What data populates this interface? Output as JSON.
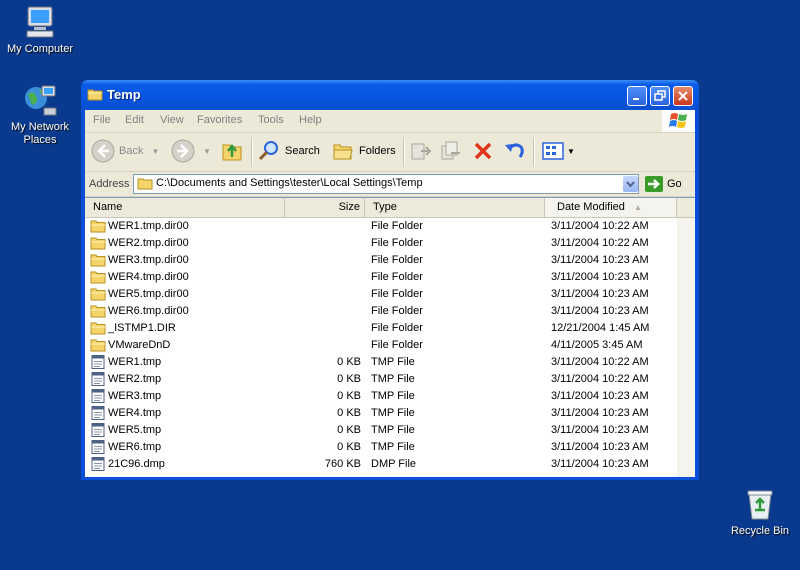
{
  "desktop": {
    "icons": [
      {
        "label": "My Computer"
      },
      {
        "label": "My Network Places"
      },
      {
        "label": "Recycle Bin"
      }
    ]
  },
  "window": {
    "title": "Temp",
    "menu": [
      "File",
      "Edit",
      "View",
      "Favorites",
      "Tools",
      "Help"
    ],
    "toolbar": {
      "back_label": "Back",
      "search_label": "Search",
      "folders_label": "Folders"
    },
    "address": {
      "label": "Address",
      "value": "C:\\Documents and Settings\\tester\\Local Settings\\Temp",
      "go_label": "Go"
    },
    "columns": {
      "name": "Name",
      "size": "Size",
      "type": "Type",
      "date": "Date Modified"
    },
    "files": [
      {
        "icon": "folder",
        "name": "WER1.tmp.dir00",
        "size": "",
        "type": "File Folder",
        "date": "3/11/2004 10:22 AM"
      },
      {
        "icon": "folder",
        "name": "WER2.tmp.dir00",
        "size": "",
        "type": "File Folder",
        "date": "3/11/2004 10:22 AM"
      },
      {
        "icon": "folder",
        "name": "WER3.tmp.dir00",
        "size": "",
        "type": "File Folder",
        "date": "3/11/2004 10:23 AM"
      },
      {
        "icon": "folder",
        "name": "WER4.tmp.dir00",
        "size": "",
        "type": "File Folder",
        "date": "3/11/2004 10:23 AM"
      },
      {
        "icon": "folder",
        "name": "WER5.tmp.dir00",
        "size": "",
        "type": "File Folder",
        "date": "3/11/2004 10:23 AM"
      },
      {
        "icon": "folder",
        "name": "WER6.tmp.dir00",
        "size": "",
        "type": "File Folder",
        "date": "3/11/2004 10:23 AM"
      },
      {
        "icon": "folder",
        "name": "_ISTMP1.DIR",
        "size": "",
        "type": "File Folder",
        "date": "12/21/2004 1:45 AM"
      },
      {
        "icon": "folder",
        "name": "VMwareDnD",
        "size": "",
        "type": "File Folder",
        "date": "4/11/2005 3:45 AM"
      },
      {
        "icon": "file",
        "name": "WER1.tmp",
        "size": "0 KB",
        "type": "TMP File",
        "date": "3/11/2004 10:22 AM"
      },
      {
        "icon": "file",
        "name": "WER2.tmp",
        "size": "0 KB",
        "type": "TMP File",
        "date": "3/11/2004 10:22 AM"
      },
      {
        "icon": "file",
        "name": "WER3.tmp",
        "size": "0 KB",
        "type": "TMP File",
        "date": "3/11/2004 10:23 AM"
      },
      {
        "icon": "file",
        "name": "WER4.tmp",
        "size": "0 KB",
        "type": "TMP File",
        "date": "3/11/2004 10:23 AM"
      },
      {
        "icon": "file",
        "name": "WER5.tmp",
        "size": "0 KB",
        "type": "TMP File",
        "date": "3/11/2004 10:23 AM"
      },
      {
        "icon": "file",
        "name": "WER6.tmp",
        "size": "0 KB",
        "type": "TMP File",
        "date": "3/11/2004 10:23 AM"
      },
      {
        "icon": "file",
        "name": "21C96.dmp",
        "size": "760 KB",
        "type": "DMP File",
        "date": "3/11/2004 10:23 AM"
      }
    ]
  },
  "colors": {
    "desktop": "#0a3a8e",
    "titlebar": "#0654e0",
    "chrome": "#ece9d8",
    "folder": "#f5d46a",
    "close": "#c5391a"
  }
}
